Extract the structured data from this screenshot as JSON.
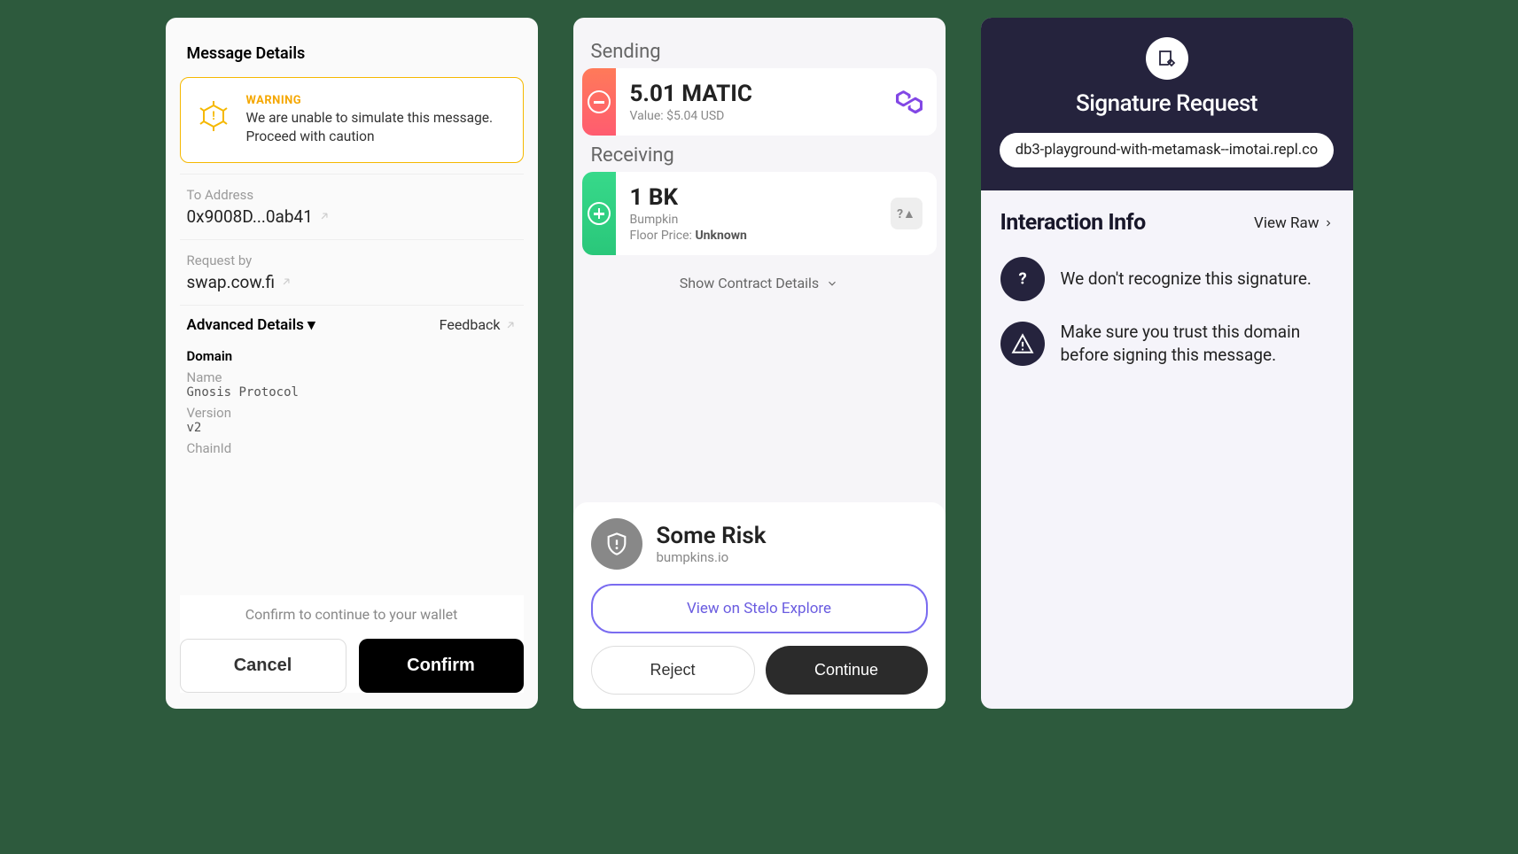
{
  "panel1": {
    "title": "Message Details",
    "warning_label": "WARNING",
    "warning_text": "We are unable to simulate this message. Proceed with caution",
    "to_label": "To Address",
    "to_value": "0x9008D...0ab41",
    "request_label": "Request by",
    "request_value": "swap.cow.fi",
    "advanced_title": "Advanced Details ▾",
    "feedback_label": "Feedback",
    "domain_head": "Domain",
    "name_label": "Name",
    "name_value": "Gnosis Protocol",
    "version_label": "Version",
    "version_value": "v2",
    "chainid_label": "ChainId",
    "confirm_hint": "Confirm to continue to your wallet",
    "cancel": "Cancel",
    "confirm": "Confirm"
  },
  "panel2": {
    "sending_label": "Sending",
    "send_amount": "5.01 MATIC",
    "send_value_label": "Value: ",
    "send_value": "$5.04 USD",
    "receiving_label": "Receiving",
    "recv_amount": "1 BK",
    "recv_name": "Bumpkin",
    "recv_floor_label": "Floor Price: ",
    "recv_floor": "Unknown",
    "show_details": "Show Contract Details",
    "risk_title": "Some Risk",
    "risk_domain": "bumpkins.io",
    "explore": "View on Stelo Explore",
    "reject": "Reject",
    "continue": "Continue"
  },
  "panel3": {
    "title": "Signature Request",
    "domain": "db3-playground-with-metamask--imotai.repl.co",
    "info_title": "Interaction Info",
    "view_raw": "View Raw",
    "msg1": "We don't recognize this signature.",
    "msg2": "Make sure you trust this domain before signing this message."
  }
}
